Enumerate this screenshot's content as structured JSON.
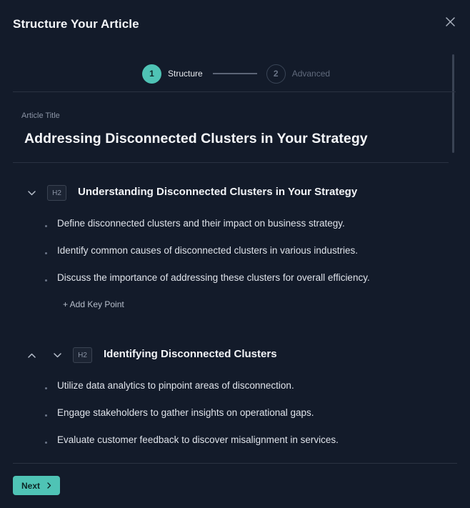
{
  "modal": {
    "title": "Structure Your Article"
  },
  "stepper": {
    "steps": [
      {
        "number": "1",
        "label": "Structure",
        "state": "active"
      },
      {
        "number": "2",
        "label": "Advanced",
        "state": "inactive"
      }
    ]
  },
  "article": {
    "title_label": "Article Title",
    "title": "Addressing Disconnected Clusters in Your Strategy"
  },
  "sections": [
    {
      "heading_level": "H2",
      "title": "Understanding Disconnected Clusters in Your Strategy",
      "key_points": [
        "Define disconnected clusters and their impact on business strategy.",
        "Identify common causes of disconnected clusters in various industries.",
        "Discuss the importance of addressing these clusters for overall efficiency."
      ],
      "add_key_point_label": "+ Add Key Point"
    },
    {
      "heading_level": "H2",
      "title": "Identifying Disconnected Clusters",
      "key_points": [
        "Utilize data analytics to pinpoint areas of disconnection.",
        "Engage stakeholders to gather insights on operational gaps.",
        "Evaluate customer feedback to discover misalignment in services."
      ]
    }
  ],
  "footer": {
    "next_label": "Next"
  },
  "colors": {
    "background": "#131b2a",
    "accent": "#4fc3b5",
    "divider": "#2a3242"
  },
  "icons": {
    "close": "close-icon",
    "collapse": "chevron-down-icon",
    "move_up": "chevron-up-icon",
    "next": "chevron-right-icon"
  }
}
